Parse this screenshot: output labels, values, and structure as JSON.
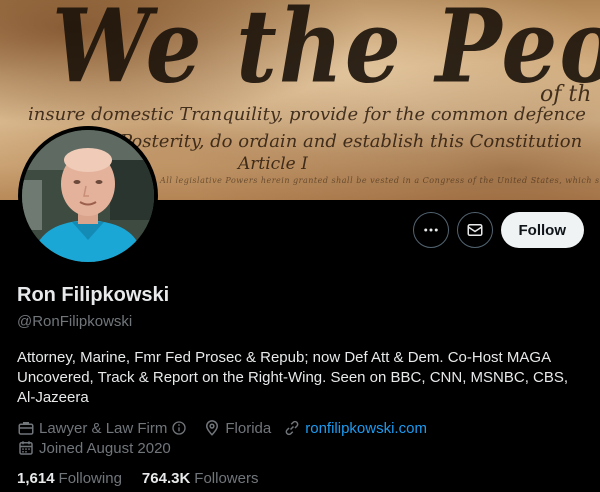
{
  "banner": {
    "headline": "We the People",
    "lines": [
      "insure domestic Tranquility, provide for the common defence",
      "Posterity, do ordain and establish this Constitution",
      "Article I",
      "All legislative Powers herein granted shall be vested in a Congress of the United States, which shall consist of a Senate and House",
      "of th"
    ]
  },
  "actions": {
    "follow_label": "Follow"
  },
  "profile": {
    "display_name": "Ron Filipkowski",
    "handle": "@RonFilipkowski",
    "bio": "Attorney, Marine, Fmr Fed Prosec & Repub; now Def Att & Dem. Co-Host MAGA Uncovered, Track & Report on the Right-Wing. Seen on BBC, CNN, MSNBC, CBS, Al-Jazeera",
    "category": "Lawyer & Law Firm",
    "location": "Florida",
    "website": "ronfilipkowski.com",
    "joined": "Joined August 2020"
  },
  "stats": {
    "following_count": "1,614",
    "following_label": "Following",
    "followers_count": "764.3K",
    "followers_label": "Followers"
  },
  "icons": [
    "more-icon",
    "message-icon",
    "briefcase-icon",
    "info-icon",
    "location-icon",
    "link-icon",
    "calendar-icon"
  ],
  "colors": {
    "accent": "#1d9bf0",
    "background": "#000000",
    "secondary_text": "#71767b"
  }
}
